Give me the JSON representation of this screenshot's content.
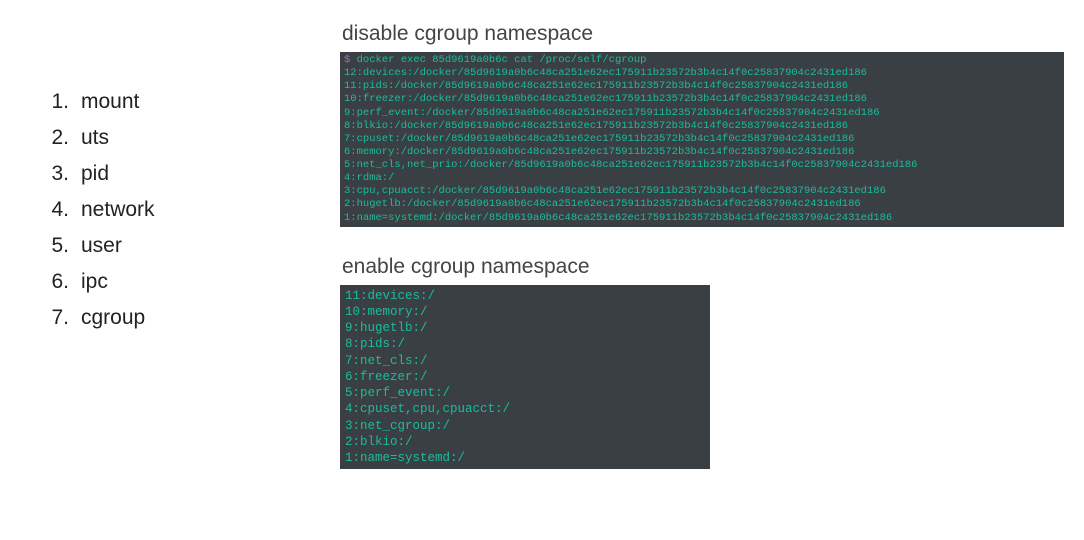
{
  "list": [
    {
      "num": "1.",
      "label": "mount"
    },
    {
      "num": "2.",
      "label": "uts"
    },
    {
      "num": "3.",
      "label": "pid"
    },
    {
      "num": "4.",
      "label": "network"
    },
    {
      "num": "5.",
      "label": "user"
    },
    {
      "num": "6.",
      "label": "ipc"
    },
    {
      "num": "7.",
      "label": "cgroup"
    }
  ],
  "section1": {
    "title": "disable cgroup namespace",
    "prompt": "$",
    "command": " docker exec 85d9619a0b6c cat /proc/self/cgroup",
    "lines": [
      "12:devices:/docker/85d9619a0b6c48ca251e62ec175911b23572b3b4c14f0c25837904c2431ed186",
      "11:pids:/docker/85d9619a0b6c48ca251e62ec175911b23572b3b4c14f0c25837904c2431ed186",
      "10:freezer:/docker/85d9619a0b6c48ca251e62ec175911b23572b3b4c14f0c25837904c2431ed186",
      "9:perf_event:/docker/85d9619a0b6c48ca251e62ec175911b23572b3b4c14f0c25837904c2431ed186",
      "8:blkio:/docker/85d9619a0b6c48ca251e62ec175911b23572b3b4c14f0c25837904c2431ed186",
      "7:cpuset:/docker/85d9619a0b6c48ca251e62ec175911b23572b3b4c14f0c25837904c2431ed186",
      "6:memory:/docker/85d9619a0b6c48ca251e62ec175911b23572b3b4c14f0c25837904c2431ed186",
      "5:net_cls,net_prio:/docker/85d9619a0b6c48ca251e62ec175911b23572b3b4c14f0c25837904c2431ed186",
      "4:rdma:/",
      "3:cpu,cpuacct:/docker/85d9619a0b6c48ca251e62ec175911b23572b3b4c14f0c25837904c2431ed186",
      "2:hugetlb:/docker/85d9619a0b6c48ca251e62ec175911b23572b3b4c14f0c25837904c2431ed186",
      "1:name=systemd:/docker/85d9619a0b6c48ca251e62ec175911b23572b3b4c14f0c25837904c2431ed186"
    ]
  },
  "section2": {
    "title": "enable cgroup namespace",
    "lines": [
      "11:devices:/",
      "10:memory:/",
      "9:hugetlb:/",
      "8:pids:/",
      "7:net_cls:/",
      "6:freezer:/",
      "5:perf_event:/",
      "4:cpuset,cpu,cpuacct:/",
      "3:net_cgroup:/",
      "2:blkio:/",
      "1:name=systemd:/"
    ]
  }
}
